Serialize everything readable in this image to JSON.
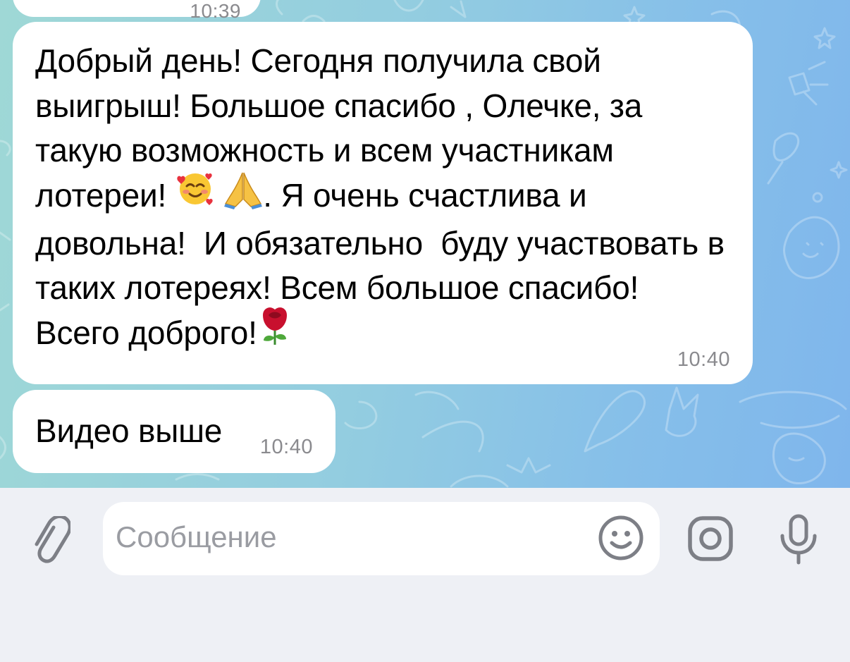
{
  "chat": {
    "messages": [
      {
        "text": "",
        "time": "10:39"
      },
      {
        "text_before": "Добрый день! Сегодня получила свой выигрыш! Большое спасибо , Олечке, за такую возможность и всем участникам лотереи! ",
        "emoji_1": "smiling-face-with-hearts",
        "emoji_2": "folded-hands",
        "text_after": ". Я очень счастлива и довольна!  И обязательно  буду участвовать в таких лотереях! Всем большое спасибо! Всего доброго!",
        "emoji_3": "rose",
        "time": "10:40"
      },
      {
        "text": "Видео выше",
        "time": "10:40"
      }
    ]
  },
  "composer": {
    "placeholder": "Сообщение",
    "icons": [
      "paperclip-icon",
      "emoji-icon",
      "camera-icon",
      "microphone-icon"
    ]
  },
  "colors": {
    "wallpaper_start": "#9fd8d6",
    "wallpaper_end": "#7fb6ec",
    "bubble": "#ffffff",
    "time": "#8a8a8e",
    "icon": "#7d7f86",
    "placeholder": "#9a9ca2"
  }
}
